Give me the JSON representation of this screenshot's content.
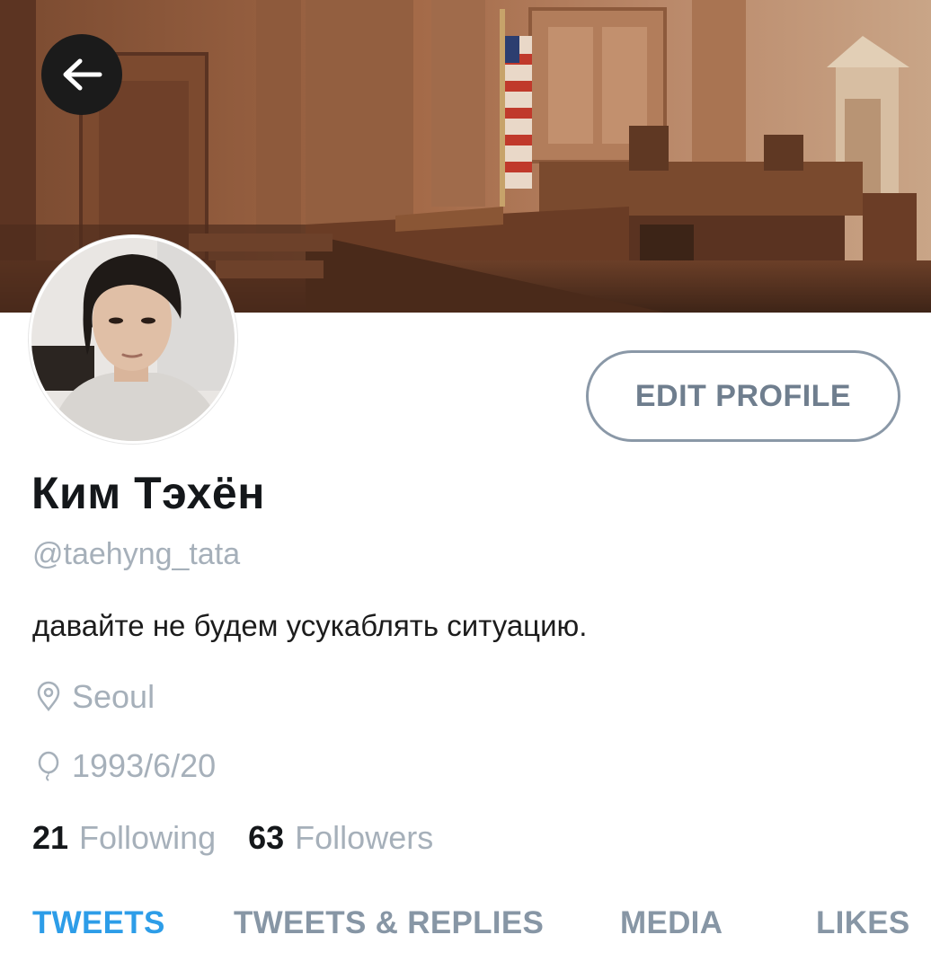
{
  "header": {
    "banner_icon": "courtroom-photo",
    "back_icon": "arrow-left-icon"
  },
  "profile": {
    "display_name": "Ким Тэхён",
    "handle": "@taehyng_tata",
    "bio": "давайте не будем усукаблять ситуацию.",
    "location": "Seoul",
    "birthday": "1993/6/20",
    "location_icon": "location-pin-icon",
    "birthday_icon": "balloon-icon"
  },
  "actions": {
    "edit_profile_label": "EDIT PROFILE"
  },
  "stats": {
    "following_count": "21",
    "following_label": "Following",
    "followers_count": "63",
    "followers_label": "Followers"
  },
  "tabs": [
    {
      "label": "TWEETS",
      "active": true
    },
    {
      "label": "TWEETS & REPLIES",
      "active": false
    },
    {
      "label": "MEDIA",
      "active": false
    },
    {
      "label": "LIKES",
      "active": false
    }
  ],
  "colors": {
    "accent": "#2d9de8",
    "muted_text": "#a6b0ba",
    "tab_inactive": "#8796a5"
  }
}
